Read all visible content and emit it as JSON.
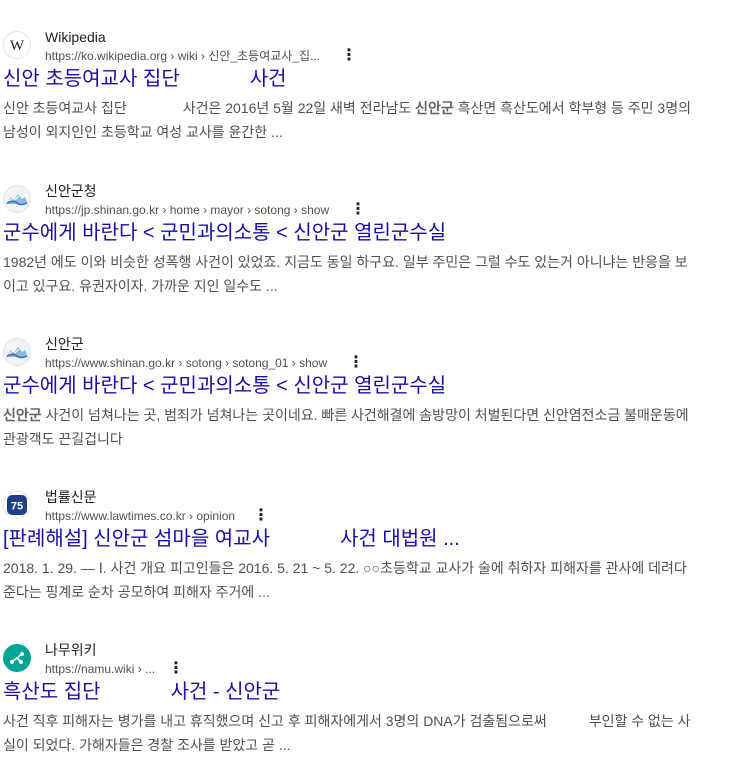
{
  "results": [
    {
      "site_name": "Wikipedia",
      "url": "https://ko.wikipedia.org › wiki › 신안_초등여교사_집...",
      "favicon": "wikipedia-logo-icon",
      "title_a": "신안 초등여교사 집단",
      "title_b": "사건",
      "snippet_1": "신안 초등여교사 집단",
      "snippet_2": "사건은 2016년 5월 22일 새벽 전라남도",
      "snippet_bold": "신안군",
      "snippet_3": "흑산면 흑산도에서 학부형 등 주민 3명의 남성이 외지인인 초등학교 여성 교사를 윤간한 ..."
    },
    {
      "site_name": "신안군청",
      "url": "https://jp.shinan.go.kr › home › mayor › sotong › show",
      "favicon": "shinan-county-logo-icon",
      "title": "군수에게 바란다 < 군민과의소통 < 신안군 열린군수실",
      "snippet": "1982년 에도 이와 비슷한 성폭행 사건이 있었죠. 지금도 동일 하구요. 일부 주민은 그럴 수도 있는거 아니냐는 반응을 보이고 있구요. 유권자이자. 가까운 지인 일수도 ..."
    },
    {
      "site_name": "신안군",
      "url": "https://www.shinan.go.kr › sotong › sotong_01 › show",
      "favicon": "shinan-county-logo-icon",
      "title": "군수에게 바란다 < 군민과의소통 < 신안군 열린군수실",
      "snippet_bold": "신안군",
      "snippet": "사건이 넘쳐나는 곳, 범죄가 넘쳐나는 곳이네요. 빠른 사건해결에 솜방망이 처벌된다면 신안염전소금 불매운동에 관광객도 끈길겁니다"
    },
    {
      "site_name": "법률신문",
      "url": "https://www.lawtimes.co.kr › opinion",
      "favicon": "lawtimes-logo-icon",
      "title_a": "[판례해설] 신안군 섬마을 여교사",
      "title_b": "사건 대법원 ...",
      "snippet": "2018. 1. 29. — Ⅰ. 사건 개요 피고인들은 2016. 5. 21 ~ 5. 22. ○○초등학교 교사가 술에 취하자 피해자를 관사에 데려다 준다는 핑계로 순차 공모하여 피해자 주거에 ..."
    },
    {
      "site_name": "나무위키",
      "url": "https://namu.wiki › ...",
      "favicon": "namuwiki-logo-icon",
      "title_a": "흑산도 집단",
      "title_b": "사건 - 신안군",
      "snippet_1": "사건 직후 피해자는 병가를 내고 휴직했으며 신고 후 피해자에게서 3명의 DNA가 검출됨으로써 ",
      "snippet_2": "부인할 수 없는 사실이 되었다. 가해자들은 경찰 조사를 받았고 곧 ..."
    }
  ],
  "menu_icon": "more-vert-icon"
}
